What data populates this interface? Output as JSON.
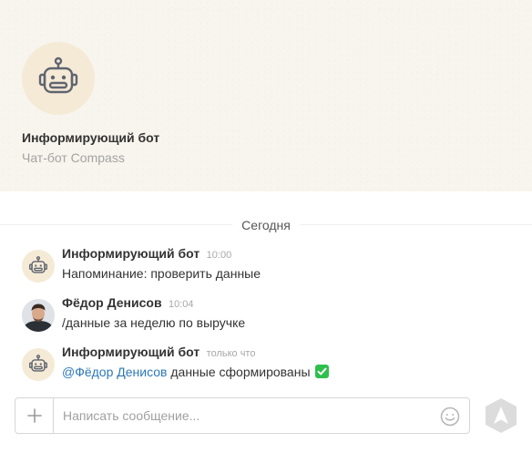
{
  "header": {
    "title": "Информирующий бот",
    "subtitle": "Чат-бот Compass",
    "avatar_icon": "robot-icon"
  },
  "date_divider": "Сегодня",
  "messages": [
    {
      "author": "Информирующий бот",
      "time": "10:00",
      "text": "Напоминание: проверить данные",
      "avatar_icon": "robot-icon"
    },
    {
      "author": "Фёдор Денисов",
      "time": "10:04",
      "text": "/данные за неделю по выручке",
      "avatar_icon": "user-photo"
    },
    {
      "author": "Информирующий бот",
      "time": "только что",
      "mention": "@Фёдор Денисов",
      "text": "данные сформированы",
      "avatar_icon": "robot-icon",
      "emoji_icon": "check-mark-icon"
    }
  ],
  "composer": {
    "placeholder": "Написать сообщение...",
    "attach_icon": "plus-icon",
    "emoji_icon": "smiley-icon",
    "send_icon": "send-arrow-icon"
  },
  "colors": {
    "hero_bg": "#f8f5ee",
    "bot_avatar_bg": "#f5ead6",
    "mention": "#2c78b8",
    "check": "#2fbf4d"
  }
}
